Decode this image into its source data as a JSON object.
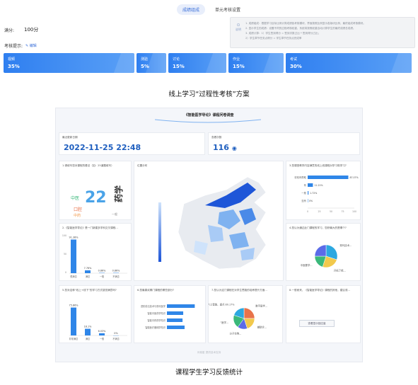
{
  "tabs": [
    {
      "label": "成绩组成",
      "active": true
    },
    {
      "label": "单元考核设置",
      "active": false
    }
  ],
  "score_row": {
    "label": "满分:",
    "value": "100分"
  },
  "assessment_row": {
    "label": "考核提示:",
    "edit_label": "编辑"
  },
  "notice": {
    "icon_label": "说明",
    "lines": [
      "1. 成绩组成：根据学习目标比例计算成绩各考核模块，界面按照比例显示各版块比例，最终组成考核模块。",
      "2. 显示学生的成绩：设置不同的过程考核权重，系统将按照权重自动计算学生的最终成绩总成绩。",
      "3. 成绩计算：1）学生签到得分 = 签到次数占比 * 签到得分占比；",
      "      2）学生章节任务点得分 = 学生章节任务点完成率"
    ]
  },
  "weight_cards": [
    {
      "name": "视频",
      "value": "35%"
    },
    {
      "name": "测验",
      "value": "5%"
    },
    {
      "name": "讨论",
      "value": "15%"
    },
    {
      "name": "作业",
      "value": "15%"
    },
    {
      "name": "考试",
      "value": "30%"
    }
  ],
  "caption_top": "线上学习“过程性考核”方案",
  "caption_bottom": "课程学生学习反馈统计",
  "dashboard": {
    "title": "《智能医学导论》课程问卷调查",
    "last_update_label": "最近更新日期",
    "last_update_value": "2022-11-25 22:48",
    "views_label": "查看次数",
    "views_value": "116",
    "q1_title": "1.请填写您对课程的看法（如：25道题填写）",
    "wordcloud": [
      "22",
      "药学",
      "中医",
      "口腔",
      "中药",
      "一般"
    ],
    "map_title": "位置分布",
    "q3_title": "3.您课堂教学内容满意的线上线课程对学习助学习?",
    "q3_categories": [
      "非常有帮助",
      "有",
      "一般",
      "没有"
    ],
    "q3_values": [
      87.07,
      11.21,
      1.72,
      0
    ],
    "q3_labels": [
      "87.07%",
      "11.21%",
      "1.72%",
      "0%"
    ],
    "q3_ticks": [
      "0",
      "25",
      "50",
      "75",
      "100"
    ],
    "q2_title": "2.《智能医学导论》是一门新建多学科交叉课程...",
    "q2_categories": [
      "很满意",
      "满意",
      "一般",
      "不满意"
    ],
    "q2_values": [
      91.38,
      7.76,
      0.86,
      0.86
    ],
    "q2_labels": [
      "91.38%",
      "7.76%",
      "0.86%",
      "0.86%"
    ],
    "q2_yticks": [
      "100",
      "50",
      "0"
    ],
    "q4_title": "4.您认为通过此门课程的学习，您获最大的是哪个?",
    "q4_slices": [
      {
        "label": "现代技术...",
        "value": 30,
        "color": "#2ca8e0"
      },
      {
        "label": "开拓了视...",
        "value": 25,
        "color": "#f2c94c"
      },
      {
        "label": "中医要学...",
        "value": 20,
        "color": "#3ab87a"
      },
      {
        "label": "",
        "value": 25,
        "color": "#5b6be8"
      }
    ],
    "q5_title": "5.您对这种“线上+线下”的学习方式感觉满意吗?",
    "q5_categories": [
      "非常满意",
      "满意",
      "一般",
      "不满意"
    ],
    "q5_values": [
      75.86,
      18.1,
      6.03,
      0
    ],
    "q5_labels": [
      "75.86%",
      "18.1%",
      "6.03%",
      "0%"
    ],
    "q6_title": "6.您最喜欢哪门课程的哪些部分?",
    "q6_categories": [
      "进阶前沿技术与现代医学",
      "智能中医药学知识",
      "智能中药药学知识",
      "智能医疗器械学知识"
    ],
    "q6_values": [
      82,
      48,
      46,
      52
    ],
    "q7_title": "7.您认为这门课程在对学生思路的培养提升方面…",
    "q7_slices": [
      {
        "label": "数字医学...",
        "value": 25,
        "color": "#e8734a"
      },
      {
        "label": "辅助诊...",
        "value": 20,
        "color": "#f2c94c"
      },
      {
        "label": "分子生物...",
        "value": 15,
        "color": "#5b6be8"
      },
      {
        "label": "“医学...",
        "value": 20,
        "color": "#3ab87a"
      },
      {
        "label": "人工智能、重点 80.17%",
        "value": 20,
        "color": "#2ca8e0"
      }
    ],
    "q8_title": "8.一般而来，《智能医学导论》课程的其他，建议或...",
    "q8_button": "查看显示回应量",
    "footer": "问卷星 提供技术支持"
  }
}
